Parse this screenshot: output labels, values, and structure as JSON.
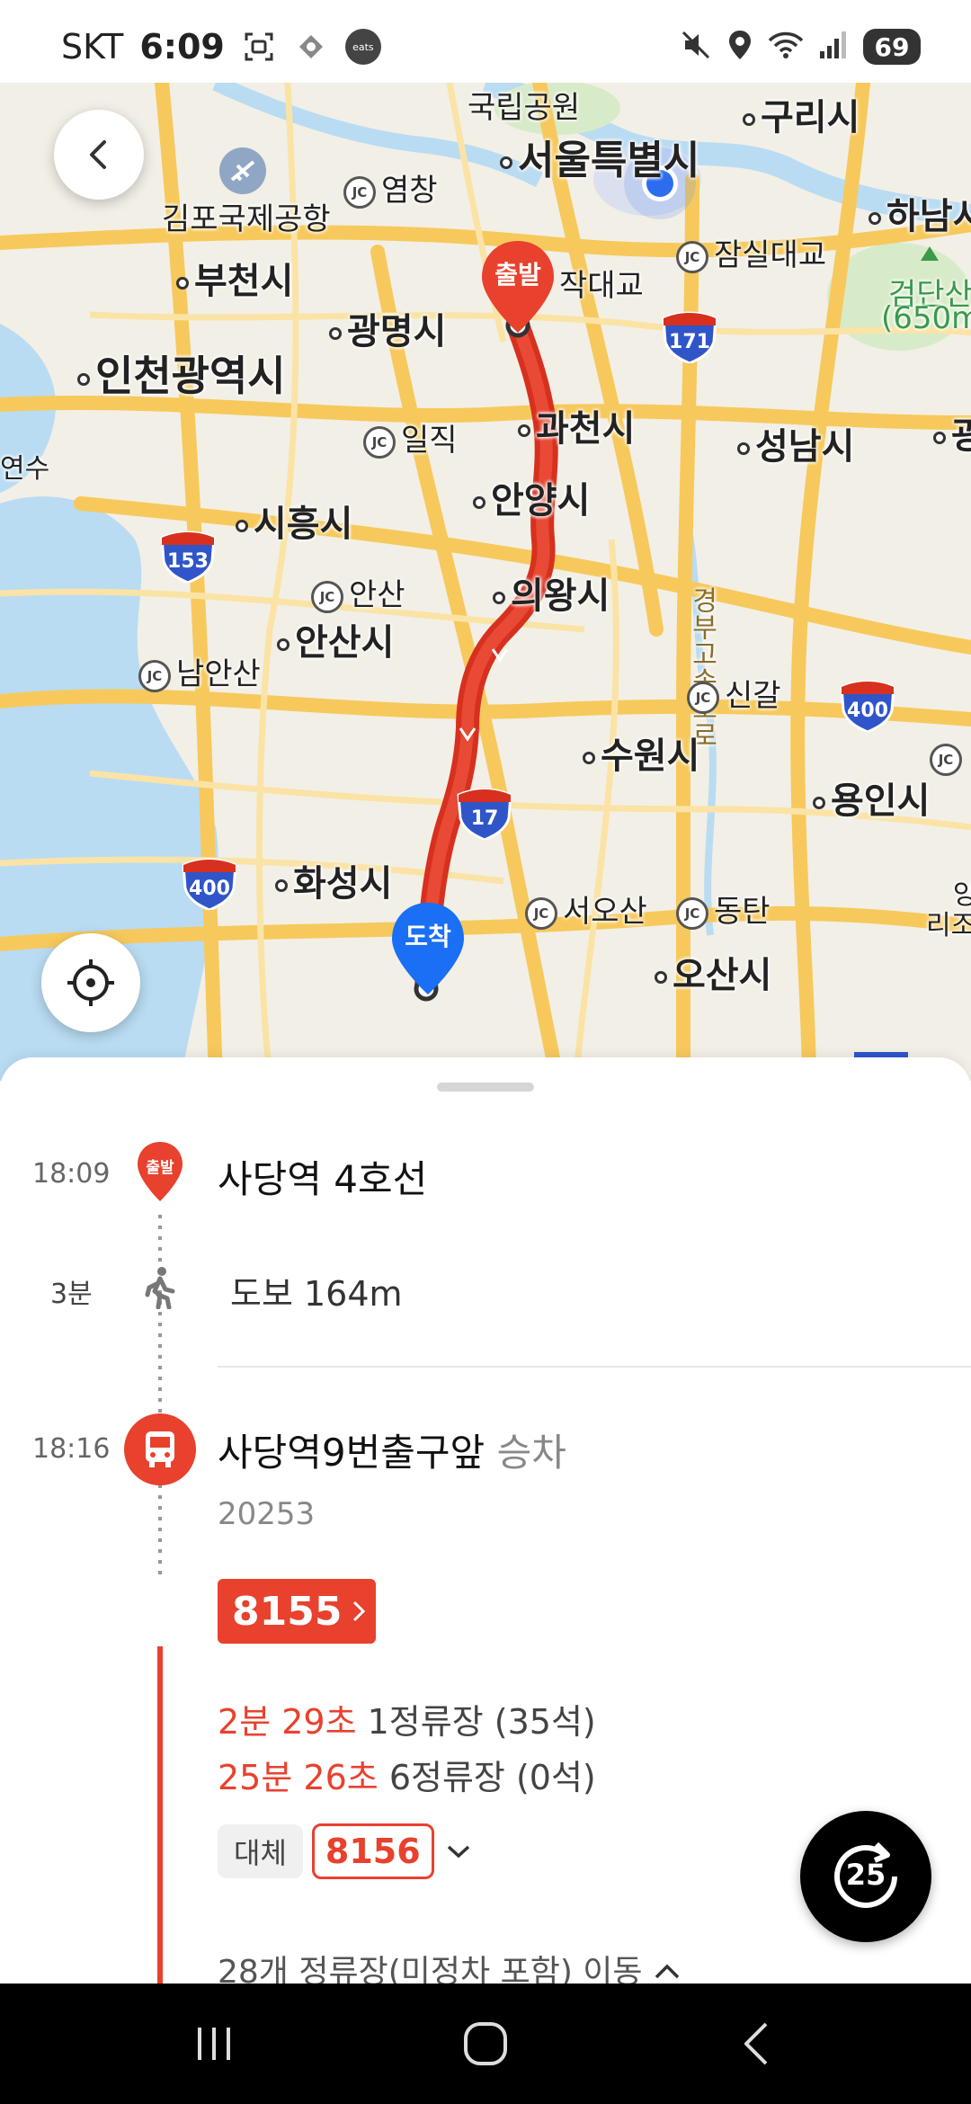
{
  "status_bar": {
    "carrier": "SKT",
    "time": "6:09",
    "eats_label": "eats",
    "battery": "69"
  },
  "map": {
    "labels": {
      "national_park": "국립공원",
      "guri": "구리시",
      "seoul": "서울특별시",
      "hanam": "하남시",
      "gimpo_airport": "김포국제공항",
      "yeomchang": "염창",
      "bucheon": "부천시",
      "jakdaegyo": "작대교",
      "jamsildaegyo": "잠실대교",
      "geomdansan": "검단산",
      "geomdansan_elev": "(650m",
      "gwangmyeong": "광명시",
      "incheon": "인천광역시",
      "gwacheon": "과천시",
      "seongnam": "성남시",
      "gwang": "광",
      "yeonsu": "연수",
      "iljik": "일직",
      "anyang": "안양시",
      "siheung": "시흥시",
      "uiwang": "의왕시",
      "ansan_jc": "안산",
      "ansan_city": "안산시",
      "gyeongbu": "경부고속도로",
      "nam_ansan": "남안산",
      "singal": "신갈",
      "suwon": "수원시",
      "yongin": "용인시",
      "hwaseong": "화성시",
      "seo_osan": "서오산",
      "dongtan": "동탄",
      "osan": "오산시",
      "edge_right_1": "앙",
      "edge_right_2": "리조",
      "jc": "JC"
    },
    "shields": {
      "r171": "171",
      "r153": "153",
      "r400a": "400",
      "r400b": "400",
      "r17": "17"
    },
    "start_pin": "출발",
    "end_pin": "도착"
  },
  "route": {
    "start": {
      "time": "18:09",
      "pin_label": "출발",
      "name": "사당역 4호선"
    },
    "walk": {
      "duration": "3분",
      "text": "도보 164m"
    },
    "board": {
      "time": "18:16",
      "stop_name": "사당역9번출구앞",
      "action": "승차",
      "stop_id": "20253",
      "bus_number": "8155",
      "arrivals": [
        {
          "time": "2분 29초",
          "info": "1정류장 (35석)"
        },
        {
          "time": "25분 26초",
          "info": "6정류장 (0석)"
        }
      ],
      "alt_label": "대체",
      "alt_bus": "8156",
      "stops_text": "28개 정류장(미정차 포함) 이동"
    }
  },
  "timer": {
    "value": "25"
  },
  "colors": {
    "accent_red": "#e8412d",
    "route_red": "#d7301f",
    "pin_blue": "#1a6ff5",
    "road_yellow": "#f7c95c",
    "water_blue": "#b9dcf2"
  }
}
